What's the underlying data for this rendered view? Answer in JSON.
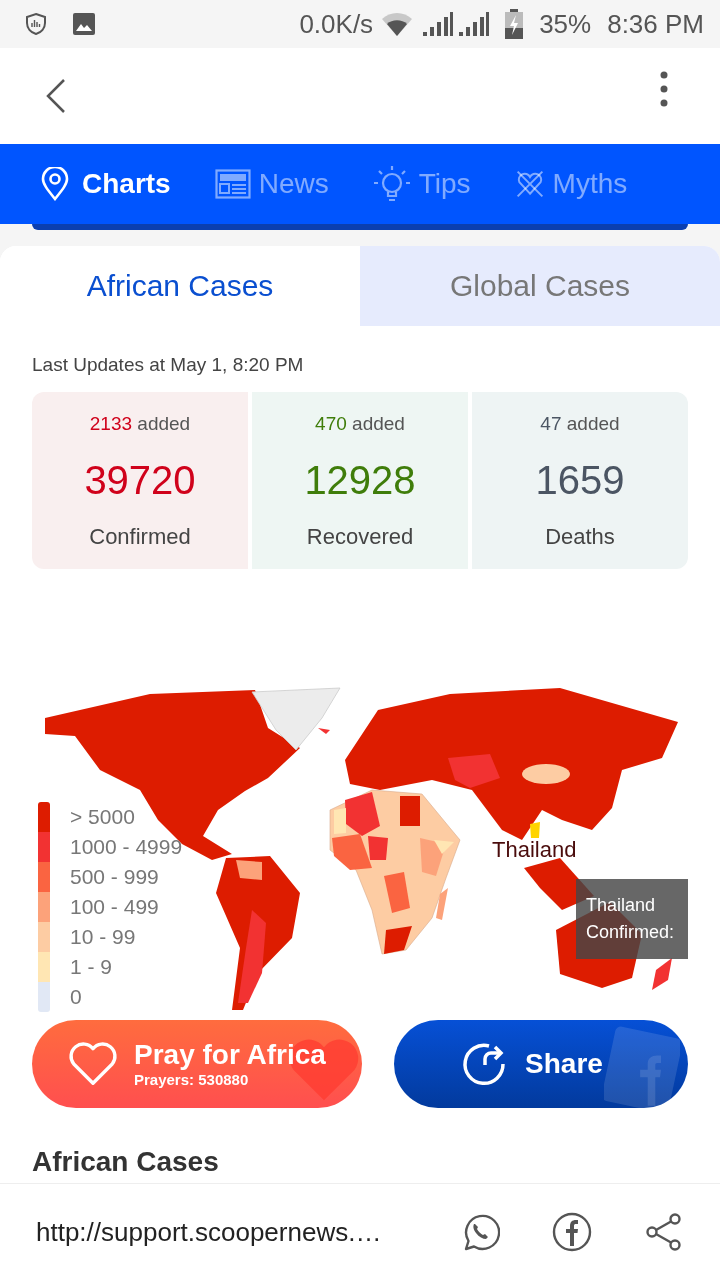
{
  "status_bar": {
    "speed": "0.0K/s",
    "battery": "35%",
    "time": "8:36 PM"
  },
  "nav_tabs": [
    {
      "kind": "pin",
      "label": "Charts",
      "selected": true
    },
    {
      "kind": "news",
      "label": "News",
      "selected": false
    },
    {
      "kind": "bulb",
      "label": "Tips",
      "selected": false
    },
    {
      "kind": "myths",
      "label": "Myths",
      "selected": false
    }
  ],
  "case_tabs": [
    {
      "label": "African Cases",
      "selected": true
    },
    {
      "label": "Global Cases",
      "selected": false
    }
  ],
  "last_updated": "Last Updates at May 1, 8:20 PM",
  "stats": [
    {
      "kind": "confirmed",
      "added": "2133",
      "added_label": "added",
      "value": "39720",
      "label": "Confirmed"
    },
    {
      "kind": "recovered",
      "added": "470",
      "added_label": "added",
      "value": "12928",
      "label": "Recovered"
    },
    {
      "kind": "deaths",
      "added": "47",
      "added_label": "added",
      "value": "1659",
      "label": "Deaths"
    }
  ],
  "map": {
    "legend": [
      {
        "label": "> 5000",
        "color": "#dd1c00"
      },
      {
        "label": "1000 - 4999",
        "color": "#f23232"
      },
      {
        "label": "500 - 999",
        "color": "#fa6441"
      },
      {
        "label": "100 - 499",
        "color": "#fca27a"
      },
      {
        "label": "10 - 99",
        "color": "#fdcca3"
      },
      {
        "label": "1 - 9",
        "color": "#ffe6b3"
      },
      {
        "label": "0",
        "color": "#e1e8f5"
      }
    ],
    "region_label": "Thailand",
    "tooltip": {
      "title": "Thailand",
      "line": "Confirmed:"
    }
  },
  "actions": [
    {
      "kind": "pray",
      "label": "Pray for Africa",
      "sublabel": "Prayers: 530880"
    },
    {
      "kind": "share",
      "label": "Share"
    }
  ],
  "section_heading": "African Cases",
  "bottom_bar": {
    "url": "http://support.scoopernews.…"
  }
}
